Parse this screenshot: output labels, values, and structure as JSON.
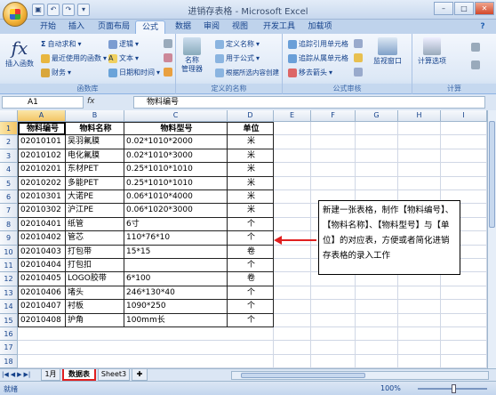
{
  "title": "进销存表格 - Microsoft Excel",
  "tabs": [
    "开始",
    "插入",
    "页面布局",
    "公式",
    "数据",
    "审阅",
    "视图",
    "开发工具",
    "加载项"
  ],
  "ribbon": {
    "insert_function": "插入函数",
    "autosum": "自动求和",
    "recent": "最近使用的函数",
    "finance": "财务",
    "logic": "逻辑",
    "text": "文本",
    "datetime": "日期和时间",
    "name_manager": "名称\n管理器",
    "define_name": "定义名称",
    "use_in_formula": "用于公式",
    "create_from_selection": "根据所选内容创建",
    "trace_precedents": "追踪引用单元格",
    "trace_dependents": "追踪从属单元格",
    "remove_arrows": "移去箭头",
    "watch_window": "监视窗口",
    "calc_options": "计算选项",
    "group_library": "函数库",
    "group_names": "定义的名称",
    "group_audit": "公式审核",
    "group_calc": "计算"
  },
  "namebox": "A1",
  "fx": "fx",
  "formula": "物料编号",
  "columns": [
    "A",
    "B",
    "C",
    "D",
    "E",
    "F",
    "G",
    "H",
    "I"
  ],
  "rows": [
    "1",
    "2",
    "3",
    "4",
    "5",
    "6",
    "7",
    "8",
    "9",
    "10",
    "11",
    "12",
    "13",
    "14",
    "15",
    "16",
    "17",
    "18"
  ],
  "table": {
    "headers": [
      "物料编号",
      "物料名称",
      "物料型号",
      "单位"
    ],
    "data": [
      [
        "02010101",
        "吴羽氟膜",
        "0.02*1010*2000",
        "米"
      ],
      [
        "02010102",
        "电化氟膜",
        "0.02*1010*3000",
        "米"
      ],
      [
        "02010201",
        "东材PET",
        "0.25*1010*1010",
        "米"
      ],
      [
        "02010202",
        "多能PET",
        "0.25*1010*1010",
        "米"
      ],
      [
        "02010301",
        "大诺PE",
        "0.06*1010*4000",
        "米"
      ],
      [
        "02010302",
        "沪江PE",
        "0.06*1020*3000",
        "米"
      ],
      [
        "02010401",
        "纸管",
        "6寸",
        "个"
      ],
      [
        "02010402",
        "管芯",
        "110*76*10",
        "个"
      ],
      [
        "02010403",
        "打包带",
        "15*15",
        "卷"
      ],
      [
        "02010404",
        "打包扣",
        "",
        "个"
      ],
      [
        "02010405",
        "LOGO胶带",
        "6*100",
        "卷"
      ],
      [
        "02010406",
        "堵头",
        "246*130*40",
        "个"
      ],
      [
        "02010407",
        "衬板",
        "1090*250",
        "个"
      ],
      [
        "02010408",
        "护角",
        "100mm长",
        "个"
      ]
    ]
  },
  "callout": "新建一张表格，制作【物料编号】、【物料名称】、【物料型号】与【单位】的对应表，方便或者简化进销存表格的录入工作",
  "sheets": [
    "1月",
    "数据表",
    "Sheet3"
  ],
  "status": "就绪",
  "zoom": "100%",
  "accent": "#e02020"
}
